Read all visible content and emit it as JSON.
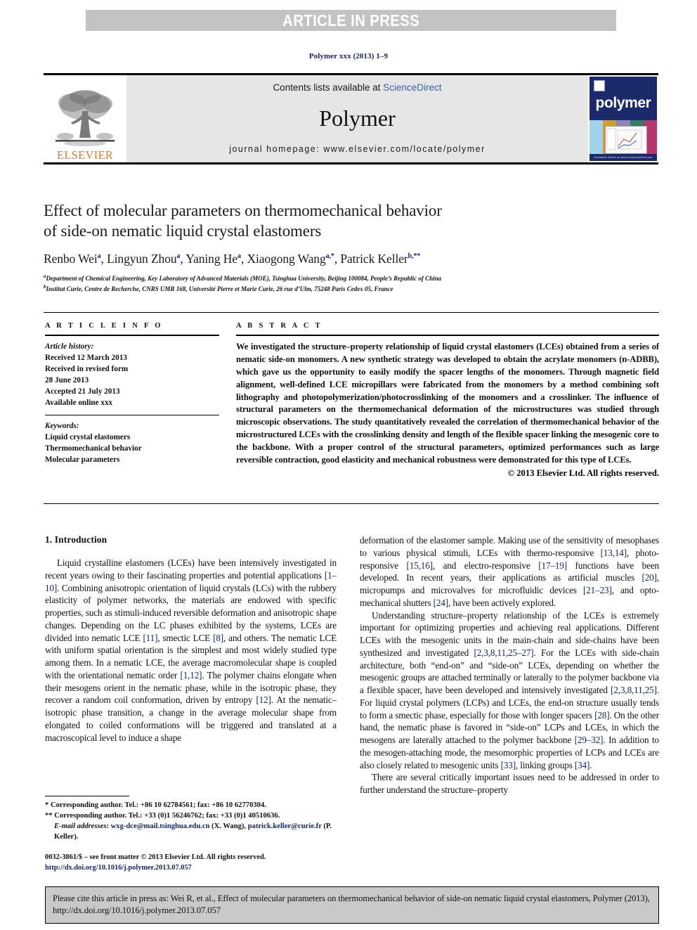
{
  "banner": {
    "text": "ARTICLE IN PRESS"
  },
  "journal_ref": "Polymer xxx (2013) 1–9",
  "masthead": {
    "contents_prefix": "Contents lists available at ",
    "sciencedirect": "ScienceDirect",
    "journal_name": "Polymer",
    "homepage": "journal homepage: www.elsevier.com/locate/polymer",
    "publisher_logo": "ELSEVIER",
    "cover_title": "polymer",
    "cover_footer": "Available online at www.sciencedirect.com"
  },
  "article": {
    "title_line1": "Effect of molecular parameters on thermomechanical behavior",
    "title_line2": "of side-on nematic liquid crystal elastomers",
    "authors": [
      {
        "name": "Renbo Wei",
        "sup": "a"
      },
      {
        "name": "Lingyun Zhou",
        "sup": "a"
      },
      {
        "name": "Yaning He",
        "sup": "a"
      },
      {
        "name": "Xiaogong Wang",
        "sup": "a,*"
      },
      {
        "name": "Patrick Keller",
        "sup": "b,**"
      }
    ],
    "affiliations": [
      {
        "mark": "a",
        "text": "Department of Chemical Engineering, Key Laboratory of Advanced Materials (MOE), Tsinghua University, Beijing 100084, People’s Republic of China"
      },
      {
        "mark": "b",
        "text": "Institut Curie, Centre de Recherche, CNRS UMR 168, Université Pierre et Marie Curie, 26 rue d’Ulm, 75248 Paris Cedex 05, France"
      }
    ]
  },
  "info": {
    "heading": "A R T I C L E  I N F O",
    "history_label": "Article history:",
    "history": [
      "Received 12 March 2013",
      "Received in revised form",
      "28 June 2013",
      "Accepted 21 July 2013",
      "Available online xxx"
    ],
    "keywords_label": "Keywords:",
    "keywords": [
      "Liquid crystal elastomers",
      "Thermomechanical behavior",
      "Molecular parameters"
    ]
  },
  "abstract": {
    "heading": "A B S T R A C T",
    "text": "We investigated the structure–property relationship of liquid crystal elastomers (LCEs) obtained from a series of nematic side-on monomers. A new synthetic strategy was developed to obtain the acrylate monomers (n-ADBB), which gave us the opportunity to easily modify the spacer lengths of the monomers. Through magnetic field alignment, well-defined LCE micropillars were fabricated from the monomers by a method combining soft lithography and photopolymerization/photocrosslinking of the monomers and a crosslinker. The influence of structural parameters on the thermomechanical deformation of the microstructures was studied through microscopic observations. The study quantitatively revealed the correlation of thermomechanical behavior of the microstructured LCEs with the crosslinking density and length of the flexible spacer linking the mesogenic core to the backbone. With a proper control of the structural parameters, optimized performances such as large reversible contraction, good elasticity and mechanical robustness were demonstrated for this type of LCEs.",
    "copyright": "© 2013 Elsevier Ltd. All rights reserved."
  },
  "body": {
    "section_heading": "1. Introduction",
    "left_paragraphs": [
      "Liquid crystalline elastomers (LCEs) have been intensively investigated in recent years owing to their fascinating properties and potential applications [1–10]. Combining anisotropic orientation of liquid crystals (LCs) with the rubbery elasticity of polymer networks, the materials are endowed with specific properties, such as stimuli-induced reversible deformation and anisotropic shape changes. Depending on the LC phases exhibited by the systems, LCEs are divided into nematic LCE [11], smectic LCE [8], and others. The nematic LCE with uniform spatial orientation is the simplest and most widely studied type among them. In a nematic LCE, the average macromolecular shape is coupled with the orientational nematic order [1,12]. The polymer chains elongate when their mesogens orient in the nematic phase, while in the isotropic phase, they recover a random coil conformation, driven by entropy [12]. At the nematic–isotropic phase transition, a change in the average molecular shape from elongated to coiled conformations will be triggered and translated at a macroscopical level to induce a shape"
    ],
    "right_paragraphs": [
      "deformation of the elastomer sample. Making use of the sensitivity of mesophases to various physical stimuli, LCEs with thermo-responsive [13,14], photo-responsive [15,16], and electro-responsive [17–19] functions have been developed. In recent years, their applications as artificial muscles [20], micropumps and microvalves for microfluidic devices [21–23], and opto-mechanical shutters [24], have been actively explored.",
      "Understanding structure–property relationship of the LCEs is extremely important for optimizing properties and achieving real applications. Different LCEs with the mesogenic units in the main-chain and side-chains have been synthesized and investigated [2,3,8,11,25–27]. For the LCEs with side-chain architecture, both “end-on” and “side-on” LCEs, depending on whether the mesogenic groups are attached terminally or laterally to the polymer backbone via a flexible spacer, have been developed and intensively investigated [2,3,8,11,25]. For liquid crystal polymers (LCPs) and LCEs, the end-on structure usually tends to form a smectic phase, especially for those with longer spacers [28]. On the other hand, the nematic phase is favored in “side-on” LCPs and LCEs, in which the mesogens are laterally attached to the polymer backbone [29–32]. In addition to the mesogen-attaching mode, the mesomorphic properties of LCPs and LCEs are also closely related to mesogenic units [33], linking groups [34].",
      "There are several critically important issues need to be addressed in order to further understand the structure–property"
    ]
  },
  "footnotes": {
    "corr1": "* Corresponding author. Tel.: +86 10 62784561; fax: +86 10 62770304.",
    "corr2": "** Corresponding author. Tel.: +33 (0)1 56246762; fax: +33 (0)1 40510636.",
    "email_label": "E-mail addresses:",
    "email1": "wxg-dce@mail.tsinghua.edu.cn",
    "email1_owner": "(X. Wang),",
    "email2": "patrick.keller@curie.fr",
    "email2_owner": "(P. Keller).",
    "frontmatter": "0032-3861/$ – see front matter © 2013 Elsevier Ltd. All rights reserved.",
    "doi": "http://dx.doi.org/10.1016/j.polymer.2013.07.057"
  },
  "cite_box": {
    "text": "Please cite this article in press as: Wei R, et al., Effect of molecular parameters on thermomechanical behavior of side-on nematic liquid crystal elastomers, Polymer (2013), http://dx.doi.org/10.1016/j.polymer.2013.07.057"
  },
  "colors": {
    "banner_bg": "#c3c3c3",
    "masthead_bg": "#e6e6e6",
    "link": "#14256b",
    "sciencedirect": "#3b5fa8",
    "elsevier_orange": "#e87722",
    "cover_blue": "#1b2a6b",
    "cite_bg": "#c9c9c9"
  }
}
